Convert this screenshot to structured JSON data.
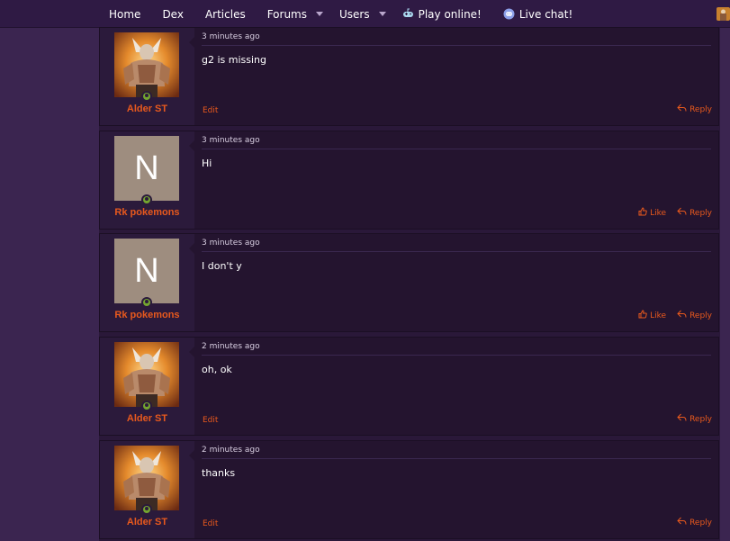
{
  "nav": {
    "items": [
      {
        "label": "Home",
        "dropdown": false
      },
      {
        "label": "Dex",
        "dropdown": false
      },
      {
        "label": "Articles",
        "dropdown": false
      },
      {
        "label": "Forums",
        "dropdown": true
      },
      {
        "label": "Users",
        "dropdown": true
      },
      {
        "label": "Play online!",
        "icon": "gamepad-icon"
      },
      {
        "label": "Live chat!",
        "icon": "discord-icon"
      }
    ]
  },
  "posts": [
    {
      "user": "Alder ST",
      "avatar": "warrior",
      "time": "3 minutes ago",
      "message": "g2 is missing",
      "edit": "Edit",
      "like": null,
      "reply": "Reply"
    },
    {
      "user": "Rk pokemons",
      "avatar": "N",
      "time": "3 minutes ago",
      "message": "Hi",
      "edit": null,
      "like": "Like",
      "reply": "Reply"
    },
    {
      "user": "Rk pokemons",
      "avatar": "N",
      "time": "3 minutes ago",
      "message": "I don't y",
      "edit": null,
      "like": "Like",
      "reply": "Reply"
    },
    {
      "user": "Alder ST",
      "avatar": "warrior",
      "time": "2 minutes ago",
      "message": "oh, ok",
      "edit": "Edit",
      "like": null,
      "reply": "Reply"
    },
    {
      "user": "Alder ST",
      "avatar": "warrior",
      "time": "2 minutes ago",
      "message": "thanks",
      "edit": "Edit",
      "like": null,
      "reply": "Reply"
    }
  ],
  "colors": {
    "accent": "#e8591d",
    "online": "#74a52f",
    "background": "#3b2550"
  }
}
